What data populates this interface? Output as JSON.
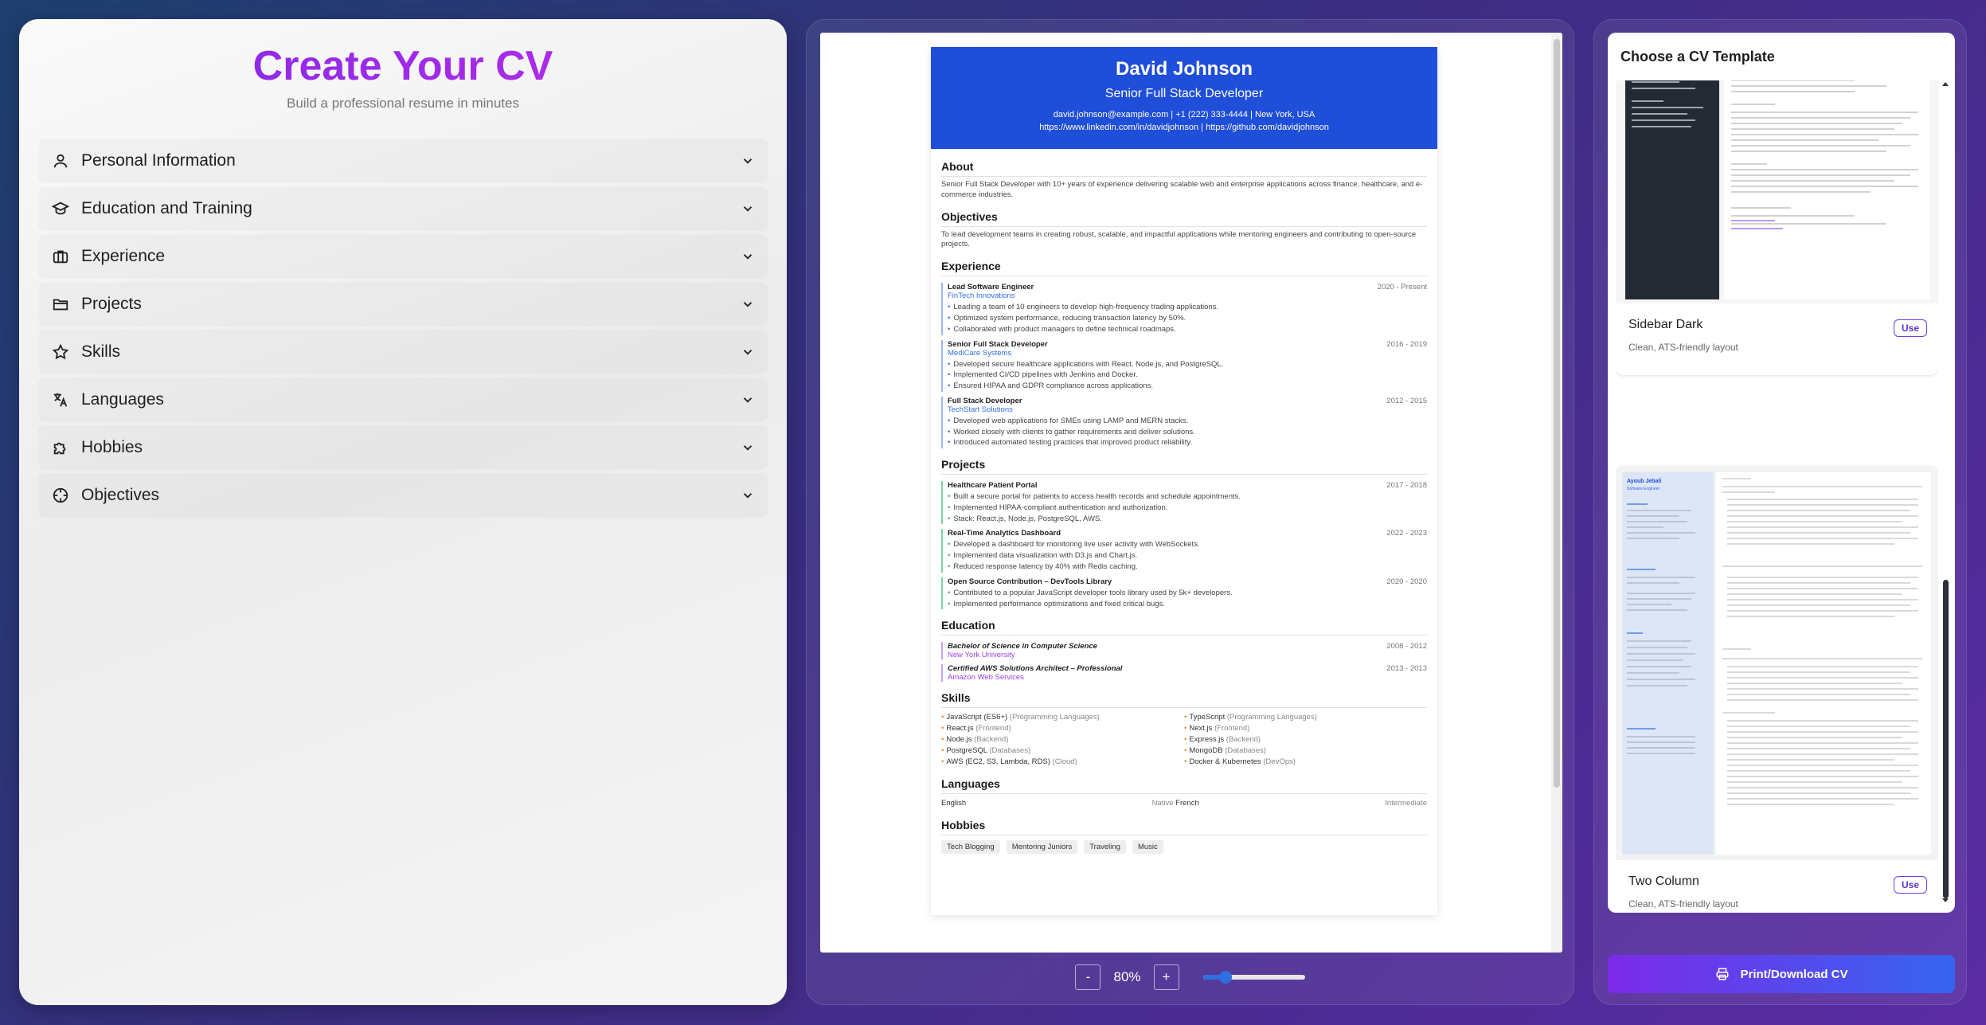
{
  "editor": {
    "title": "Create Your CV",
    "subtitle": "Build a professional resume in minutes",
    "sections": [
      {
        "label": "Personal Information",
        "icon": "person-icon"
      },
      {
        "label": "Education and Training",
        "icon": "graduation-cap-icon"
      },
      {
        "label": "Experience",
        "icon": "briefcase-icon"
      },
      {
        "label": "Projects",
        "icon": "folder-icon"
      },
      {
        "label": "Skills",
        "icon": "star-icon"
      },
      {
        "label": "Languages",
        "icon": "translate-icon"
      },
      {
        "label": "Hobbies",
        "icon": "puzzle-icon"
      },
      {
        "label": "Objectives",
        "icon": "target-icon"
      }
    ]
  },
  "cv": {
    "name": "David Johnson",
    "role": "Senior Full Stack Developer",
    "contact": "david.johnson@example.com | +1 (222) 333-4444 | New York, USA",
    "links": "https://www.linkedin.com/in/davidjohnson | https://github.com/davidjohnson",
    "about_title": "About",
    "about": "Senior Full Stack Developer with 10+ years of experience delivering scalable web and enterprise applications across finance, healthcare, and e-commerce industries.",
    "objectives_title": "Objectives",
    "objectives": "To lead development teams in creating robust, scalable, and impactful applications while mentoring engineers and contributing to open-source projects.",
    "experience_title": "Experience",
    "experience": [
      {
        "title": "Lead Software Engineer",
        "org": "FinTech Innovations",
        "dates": "2020 - Present",
        "bullets": [
          "Leading a team of 10 engineers to develop high-frequency trading applications.",
          "Optimized system performance, reducing transaction latency by 50%.",
          "Collaborated with product managers to define technical roadmaps."
        ]
      },
      {
        "title": "Senior Full Stack Developer",
        "org": "MediCare Systems",
        "dates": "2016 - 2019",
        "bullets": [
          "Developed secure healthcare applications with React, Node.js, and PostgreSQL.",
          "Implemented CI/CD pipelines with Jenkins and Docker.",
          "Ensured HIPAA and GDPR compliance across applications."
        ]
      },
      {
        "title": "Full Stack Developer",
        "org": "TechStart Solutions",
        "dates": "2012 - 2015",
        "bullets": [
          "Developed web applications for SMEs using LAMP and MERN stacks.",
          "Worked closely with clients to gather requirements and deliver solutions.",
          "Introduced automated testing practices that improved product reliability."
        ]
      }
    ],
    "projects_title": "Projects",
    "projects": [
      {
        "title": "Healthcare Patient Portal",
        "dates": "2017 - 2018",
        "bullets": [
          "Built a secure portal for patients to access health records and schedule appointments.",
          "Implemented HIPAA-compliant authentication and authorization.",
          "Stack: React.js, Node.js, PostgreSQL, AWS."
        ]
      },
      {
        "title": "Real-Time Analytics Dashboard",
        "dates": "2022 - 2023",
        "bullets": [
          "Developed a dashboard for monitoring live user activity with WebSockets.",
          "Implemented data visualization with D3.js and Chart.js.",
          "Reduced response latency by 40% with Redis caching."
        ]
      },
      {
        "title": "Open Source Contribution – DevTools Library",
        "dates": "2020 - 2020",
        "bullets": [
          "Contributed to a popular JavaScript developer tools library used by 5k+ developers.",
          "Implemented performance optimizations and fixed critical bugs."
        ]
      }
    ],
    "education_title": "Education",
    "education": [
      {
        "title": "Bachelor of Science in Computer Science",
        "org": "New York University",
        "dates": "2008 - 2012"
      },
      {
        "title": "Certified AWS Solutions Architect – Professional",
        "org": "Amazon Web Services",
        "dates": "2013 - 2013"
      }
    ],
    "skills_title": "Skills",
    "skills": [
      {
        "name": "JavaScript (ES6+)",
        "cat": "(Programming Languages)"
      },
      {
        "name": "TypeScript",
        "cat": "(Programming Languages)"
      },
      {
        "name": "React.js",
        "cat": "(Frontend)"
      },
      {
        "name": "Next.js",
        "cat": "(Frontend)"
      },
      {
        "name": "Node.js",
        "cat": "(Backend)"
      },
      {
        "name": "Express.js",
        "cat": "(Backend)"
      },
      {
        "name": "PostgreSQL",
        "cat": "(Databases)"
      },
      {
        "name": "MongoDB",
        "cat": "(Databases)"
      },
      {
        "name": "AWS (EC2, S3, Lambda, RDS)",
        "cat": "(Cloud)"
      },
      {
        "name": "Docker & Kubernetes",
        "cat": "(DevOps)"
      }
    ],
    "languages_title": "Languages",
    "languages": {
      "l1": "English",
      "l1_level": "Native",
      "l2": "French",
      "l2_level": "Intermediate"
    },
    "hobbies_title": "Hobbies",
    "hobbies": [
      "Tech Blogging",
      "Mentoring Juniors",
      "Traveling",
      "Music"
    ]
  },
  "zoom": {
    "minus": "-",
    "value": "80%",
    "plus": "+",
    "level": 0.22
  },
  "templates": {
    "title": "Choose a CV Template",
    "items": [
      {
        "name": "Sidebar Dark",
        "desc": "Clean, ATS-friendly layout",
        "button": "Use"
      },
      {
        "name": "Two Column",
        "desc": "Clean, ATS-friendly layout",
        "button": "Use"
      }
    ],
    "preview": {
      "name": "Ayoub Jebali",
      "role": "Software Engineer"
    }
  },
  "print_button": "Print/Download CV",
  "colors": {
    "accent": "#7c2ae8",
    "cv_header": "#1f4ed8",
    "link": "#2f6fe0"
  }
}
